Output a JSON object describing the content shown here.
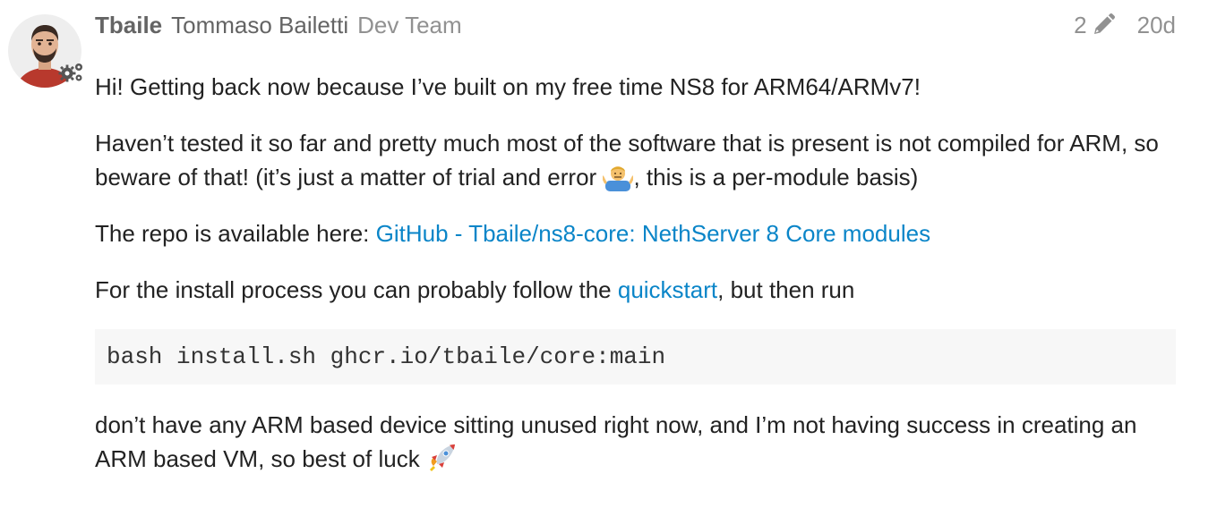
{
  "post": {
    "username": "Tbaile",
    "full_name": "Tommaso Bailetti",
    "group": "Dev Team",
    "edit_count": "2",
    "date": "20d",
    "avatar_icon": "user-avatar",
    "flair_icon": "gears-icon",
    "paragraphs": {
      "p1": "Hi! Getting back now because I’ve built on my free time NS8 for ARM64/ARMv7!",
      "p2_before_emoji": "Haven’t tested it so far and pretty much most of the software that is present is not compiled for ARM, so beware of that! (it’s just a matter of trial and error ",
      "p2_after_emoji": ", this is a per-module basis)",
      "p3_before_link": "The repo is available here: ",
      "p3_link": "GitHub - Tbaile/ns8-core: NethServer 8 Core modules",
      "p4_before_link": "For the install process you can probably follow the ",
      "p4_link": "quickstart",
      "p4_after_link": ", but then run",
      "p5_text": "don’t have any ARM based device sitting unused right now, and I’m not having success in creating an ARM based VM, so best of luck "
    },
    "code": "bash install.sh ghcr.io/tbaile/core:main",
    "emojis": {
      "shrug": "man-shrugging-emoji",
      "rocket": "rocket-emoji"
    }
  },
  "colors": {
    "link": "#0a85c8",
    "meta": "#919191",
    "username": "#646464",
    "text": "#222222",
    "code_bg": "#f7f7f7"
  }
}
